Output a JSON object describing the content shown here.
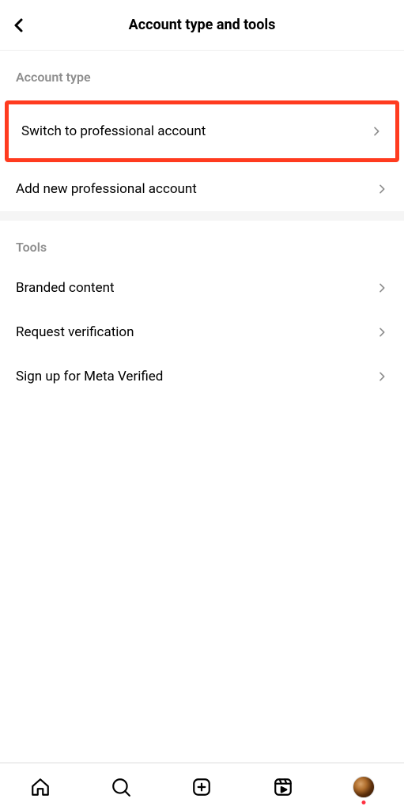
{
  "header": {
    "title": "Account type and tools"
  },
  "sections": {
    "account_type": {
      "heading": "Account type",
      "items": [
        {
          "label": "Switch to professional account"
        },
        {
          "label": "Add new professional account"
        }
      ]
    },
    "tools": {
      "heading": "Tools",
      "items": [
        {
          "label": "Branded content"
        },
        {
          "label": "Request verification"
        },
        {
          "label": "Sign up for Meta Verified"
        }
      ]
    }
  },
  "nav": {
    "home": "home-icon",
    "search": "search-icon",
    "create": "create-icon",
    "reels": "reels-icon",
    "profile": "profile-avatar"
  }
}
